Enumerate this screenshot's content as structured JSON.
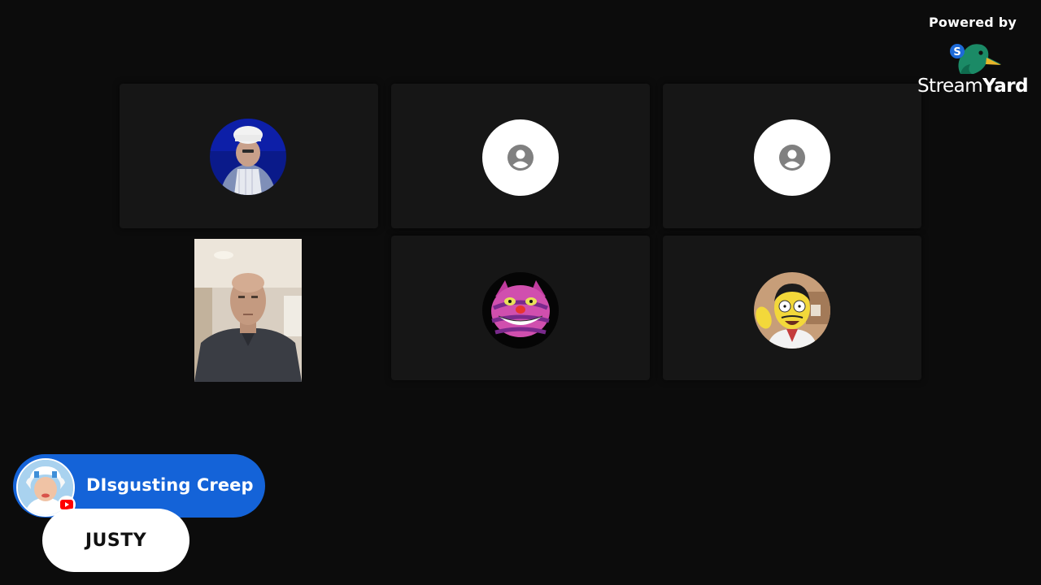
{
  "branding": {
    "powered_by": "Powered by",
    "brand_regular": "Stream",
    "brand_bold": "Yard",
    "logo_icon": "streamyard-duck-logo"
  },
  "participants": [
    {
      "avatar_type": "photo",
      "icon": "chef-avatar",
      "has_name": false
    },
    {
      "avatar_type": "default",
      "icon": "person-icon",
      "has_name": false
    },
    {
      "avatar_type": "default",
      "icon": "person-icon",
      "has_name": false
    },
    {
      "avatar_type": "video",
      "icon": "camera-feed",
      "has_name": false
    },
    {
      "avatar_type": "photo",
      "icon": "cheshire-cat-avatar",
      "has_name": false
    },
    {
      "avatar_type": "photo",
      "icon": "cartoon-man-avatar",
      "has_name": false
    }
  ],
  "comment": {
    "author": "DIsgusting Creep",
    "text": "JUSTY",
    "platform_icon": "youtube-icon"
  },
  "colors": {
    "background": "#0c0c0c",
    "tile": "#161616",
    "comment_accent": "#1463d8",
    "comment_text_bg": "#ffffff"
  }
}
